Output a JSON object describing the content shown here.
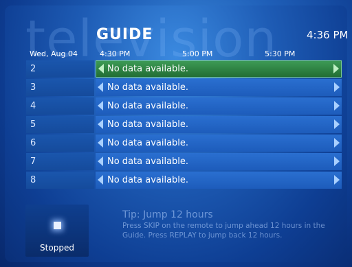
{
  "background_word": "television",
  "header": {
    "title": "GUIDE",
    "clock": "4:36 PM"
  },
  "timebar": {
    "date": "Wed, Aug 04",
    "slots": [
      "4:30 PM",
      "5:00 PM",
      "5:30 PM"
    ]
  },
  "channels": [
    {
      "number": "2",
      "program": "No data available.",
      "selected": true
    },
    {
      "number": "3",
      "program": "No data available."
    },
    {
      "number": "4",
      "program": "No data available."
    },
    {
      "number": "5",
      "program": "No data available."
    },
    {
      "number": "6",
      "program": "No data available."
    },
    {
      "number": "7",
      "program": "No data available."
    },
    {
      "number": "8",
      "program": "No data available."
    }
  ],
  "player": {
    "status": "Stopped",
    "icon": "stop-icon"
  },
  "tip": {
    "title": "Tip: Jump 12 hours",
    "text": "Press SKIP on the remote to jump ahead 12 hours in the Guide. Press REPLAY to jump back 12 hours."
  },
  "colors": {
    "selected_row": "#2f8a47",
    "row": "#2466c4",
    "channel_cell": "#1751a6"
  }
}
